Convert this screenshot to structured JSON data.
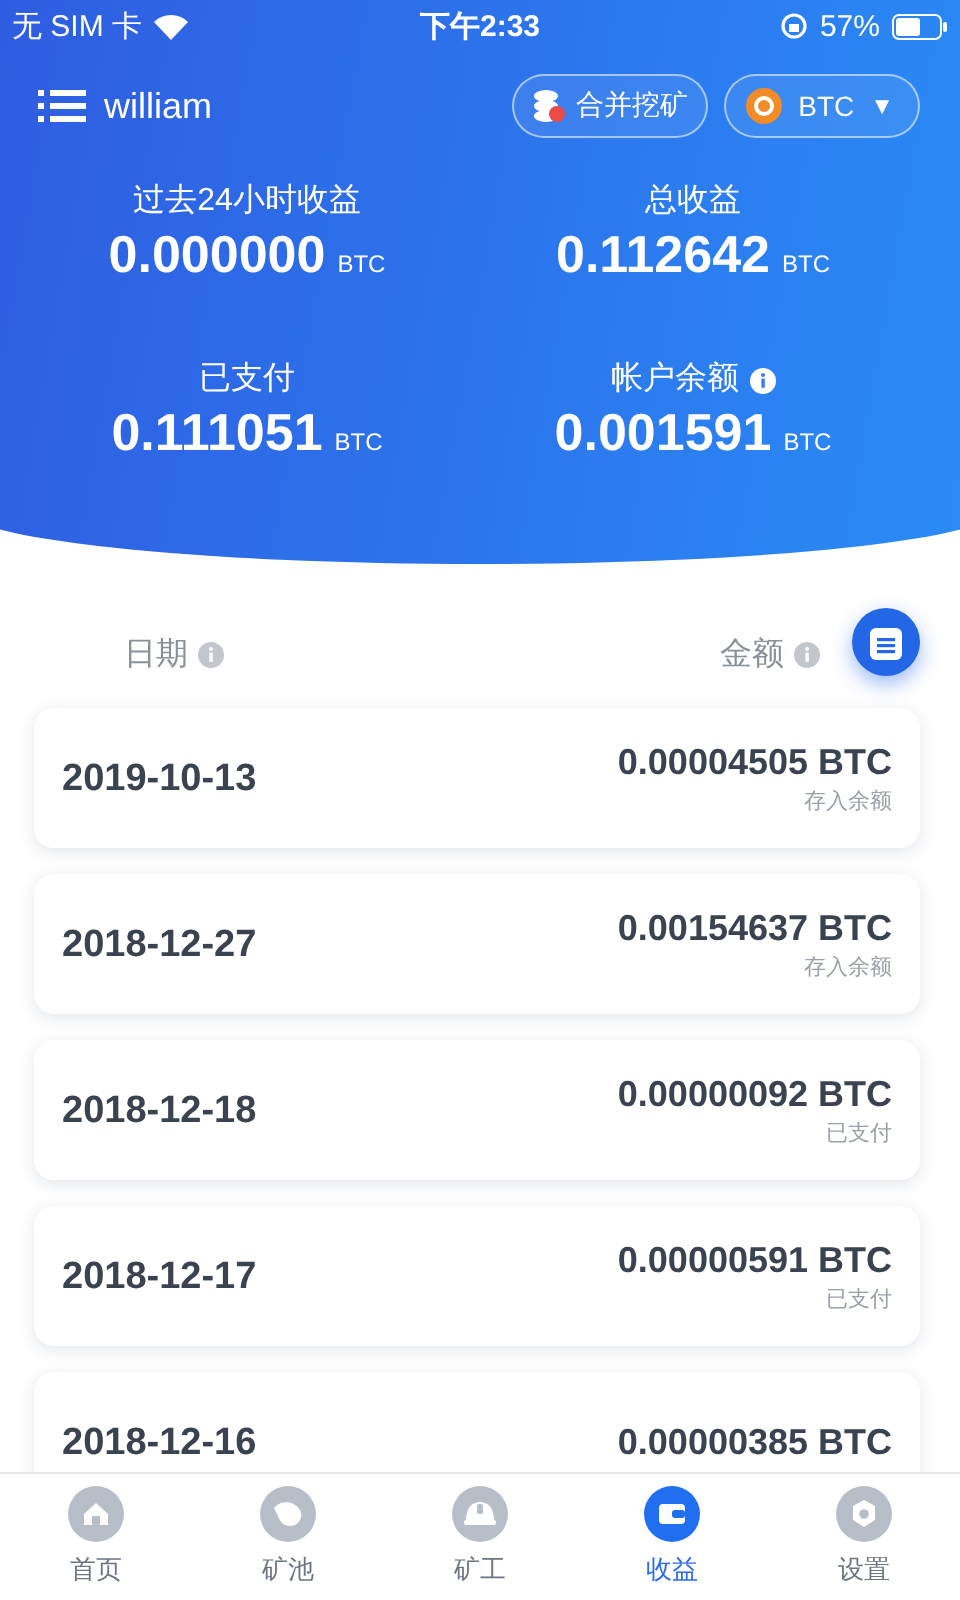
{
  "status_bar": {
    "carrier": "无 SIM 卡",
    "time": "下午2:33",
    "battery": "57%"
  },
  "top_bar": {
    "username": "william",
    "merge_button": "合并挖矿",
    "coin": "BTC",
    "caret": "▼"
  },
  "stats": [
    {
      "label": "过去24小时收益",
      "value": "0.000000",
      "unit": "BTC",
      "info": false
    },
    {
      "label": "总收益",
      "value": "0.112642",
      "unit": "BTC",
      "info": false
    },
    {
      "label": "已支付",
      "value": "0.111051",
      "unit": "BTC",
      "info": false
    },
    {
      "label": "帐户余额",
      "value": "0.001591",
      "unit": "BTC",
      "info": true
    }
  ],
  "columns": [
    {
      "label": "日期",
      "info": true
    },
    {
      "label": "金额",
      "info": true
    }
  ],
  "rows": [
    {
      "date": "2019-10-13",
      "amount": "0.00004505 BTC",
      "note": "存入余额"
    },
    {
      "date": "2018-12-27",
      "amount": "0.00154637 BTC",
      "note": "存入余额"
    },
    {
      "date": "2018-12-18",
      "amount": "0.00000092 BTC",
      "note": "已支付"
    },
    {
      "date": "2018-12-17",
      "amount": "0.00000591 BTC",
      "note": "已支付"
    },
    {
      "date": "2018-12-16",
      "amount": "0.00000385 BTC"
    }
  ],
  "tabs": [
    {
      "label": "首页",
      "kind": "home",
      "selected": false
    },
    {
      "label": "矿池",
      "kind": "fish",
      "selected": false
    },
    {
      "label": "矿工",
      "kind": "helmet",
      "selected": false
    },
    {
      "label": "收益",
      "kind": "wallet",
      "selected": true
    },
    {
      "label": "设置",
      "kind": "gear",
      "selected": false
    }
  ]
}
